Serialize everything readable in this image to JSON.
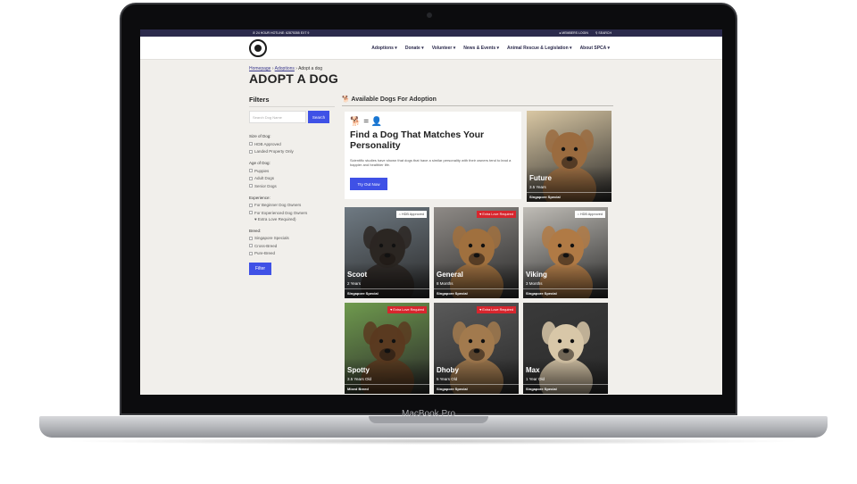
{
  "device": {
    "model_label": "MacBook Pro"
  },
  "topbar": {
    "hotline": "24 HOUR HOTLINE: 62875355 EXT 9",
    "members_login": "MEMBERS LOGIN",
    "search": "SEARCH"
  },
  "nav": {
    "items": [
      {
        "label": "Adoptions ▾"
      },
      {
        "label": "Donate ▾"
      },
      {
        "label": "Volunteer ▾"
      },
      {
        "label": "News & Events ▾"
      },
      {
        "label": "Animal Rescue & Legislation ▾"
      },
      {
        "label": "About SPCA ▾"
      }
    ]
  },
  "breadcrumb": {
    "home": "Homepage",
    "sep1": " › ",
    "adoptions": "Adoptions",
    "sep2": " › ",
    "current": "Adopt a dog"
  },
  "page_title": "ADOPT A DOG",
  "filters": {
    "title": "Filters",
    "search_placeholder": "Search Dog Name",
    "search_button": "Search",
    "size_label": "Size of Dog:",
    "size_options": [
      "HDB Approved",
      "Landed Property Only"
    ],
    "age_label": "Age of Dog:",
    "age_options": [
      "Puppies",
      "Adult Dogs",
      "Senior Dogs"
    ],
    "experience_label": "Experience:",
    "experience_options": [
      "For Beginner Dog Owners",
      "For Experienced Dog Owners"
    ],
    "experience_sub": "♥ Extra Love Required)",
    "breed_label": "Breed:",
    "breed_options": [
      "Singapore Specials",
      "Cross-Breed",
      "Pure-Breed"
    ],
    "filter_button": "Filter"
  },
  "available": {
    "heading": "🐕 Available Dogs For Adoption"
  },
  "promo": {
    "icons": "🐕 = 👤",
    "title": "Find a Dog That Matches Your Personality",
    "text": "Scientific studies have shown that dogs that have a similar personality with their owners tend to lead a happier and healthier life.",
    "button": "Try Out Now"
  },
  "dogs": [
    {
      "name": "Future",
      "age": "3.5 Years",
      "breed": "Singapore Special",
      "badge": "",
      "color": "#9a6b3f"
    },
    {
      "name": "Scoot",
      "age": "2 Years",
      "breed": "Singapore Special",
      "badge": "HDB Approved",
      "color": "#2b2622"
    },
    {
      "name": "General",
      "age": "8 Months",
      "breed": "Singapore Special",
      "badge": "Extra Love Required",
      "color": "#a0703e"
    },
    {
      "name": "Viking",
      "age": "3 Months",
      "breed": "Singapore Special",
      "badge": "HDB Approved",
      "color": "#b07a45"
    },
    {
      "name": "Spotty",
      "age": "3.5 Years Old",
      "breed": "Mixed Breed",
      "badge": "Extra Love Required",
      "color": "#5a3a20"
    },
    {
      "name": "Dhoby",
      "age": "5 Years Old",
      "breed": "Singapore Special",
      "badge": "Extra Love Required",
      "color": "#a27a4e"
    },
    {
      "name": "Max",
      "age": "1 Year Old",
      "breed": "Singapore Special",
      "badge": "",
      "color": "#d8c7a8"
    }
  ],
  "colors": {
    "brand": "#2b2a4c",
    "accent": "#3f51e6",
    "love_badge": "#d7262e"
  }
}
